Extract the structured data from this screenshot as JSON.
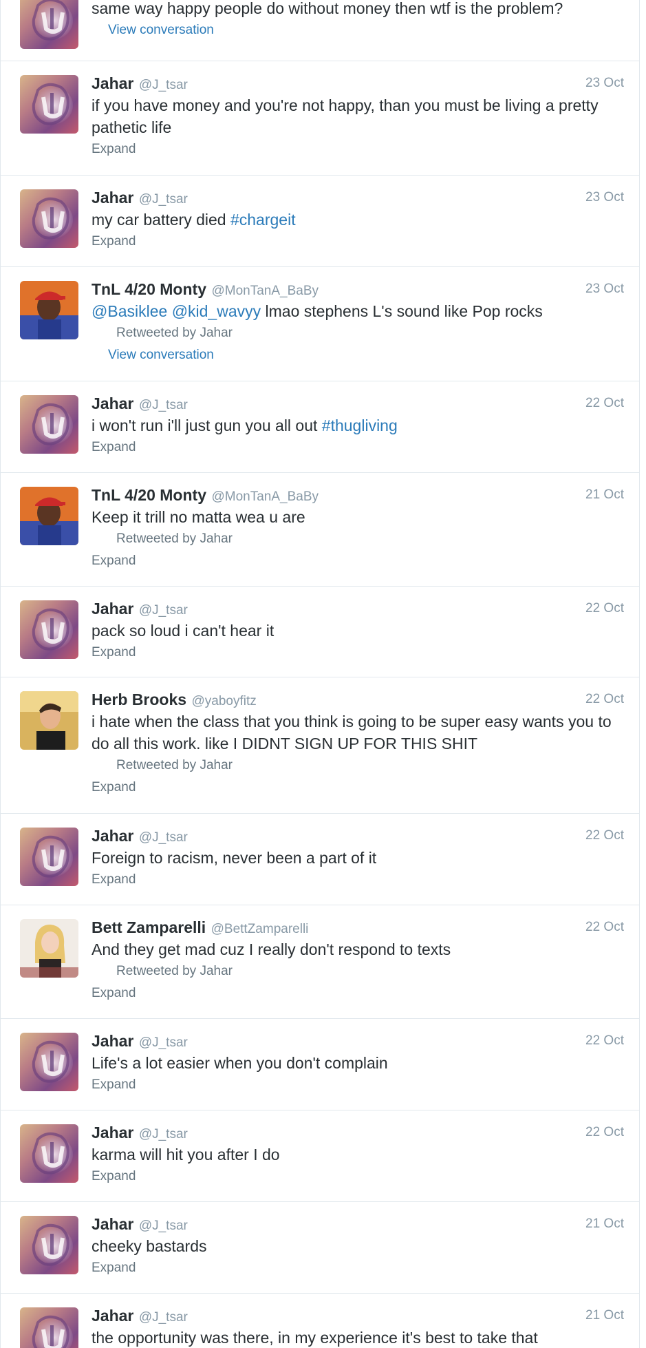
{
  "timeline": {
    "tweets": [
      {
        "avatar": "jahar-avatar",
        "text_parts": [
          {
            "t": "same way happy people do without money then wtf is the problem?"
          }
        ],
        "retweeted_by": "",
        "action": "View conversation"
      },
      {
        "name": "Jahar",
        "handle": "@J_tsar",
        "time": "23 Oct",
        "avatar": "jahar-avatar",
        "text_parts": [
          {
            "t": "if you have money and you're not happy, than you must be living a pretty pathetic life"
          }
        ],
        "retweeted_by": "",
        "action": "Expand"
      },
      {
        "name": "Jahar",
        "handle": "@J_tsar",
        "time": "23 Oct",
        "avatar": "jahar-avatar",
        "text_parts": [
          {
            "t": "my car battery died "
          },
          {
            "t": "#chargeit",
            "link": true
          }
        ],
        "retweeted_by": "",
        "action": "Expand"
      },
      {
        "name": "TnL 4/20 Monty",
        "handle": "@MonTanA_BaBy",
        "time": "23 Oct",
        "avatar": "monty-avatar",
        "text_parts": [
          {
            "t": "@Basiklee",
            "link": true
          },
          {
            "t": " "
          },
          {
            "t": "@kid_wavyy",
            "link": true
          },
          {
            "t": " lmao stephens L's sound like Pop rocks"
          }
        ],
        "retweeted_by": "Retweeted by Jahar",
        "action": "View conversation"
      },
      {
        "name": "Jahar",
        "handle": "@J_tsar",
        "time": "22 Oct",
        "avatar": "jahar-avatar",
        "text_parts": [
          {
            "t": "i won't run i'll just gun you all out "
          },
          {
            "t": "#thugliving",
            "link": true
          }
        ],
        "retweeted_by": "",
        "action": "Expand"
      },
      {
        "name": "TnL 4/20 Monty",
        "handle": "@MonTanA_BaBy",
        "time": "21 Oct",
        "avatar": "monty-avatar",
        "text_parts": [
          {
            "t": "Keep it trill no matta wea u are"
          }
        ],
        "retweeted_by": "Retweeted by Jahar",
        "action": "Expand"
      },
      {
        "name": "Jahar",
        "handle": "@J_tsar",
        "time": "22 Oct",
        "avatar": "jahar-avatar",
        "text_parts": [
          {
            "t": "pack so loud i can't hear it"
          }
        ],
        "retweeted_by": "",
        "action": "Expand"
      },
      {
        "name": "Herb Brooks",
        "handle": "@yaboyfitz",
        "time": "22 Oct",
        "avatar": "herb-avatar",
        "text_parts": [
          {
            "t": "i hate when the class that you think is going to be super easy wants you to do all this work. like I DIDNT SIGN UP FOR THIS SHIT"
          }
        ],
        "retweeted_by": "Retweeted by Jahar",
        "action": "Expand"
      },
      {
        "name": "Jahar",
        "handle": "@J_tsar",
        "time": "22 Oct",
        "avatar": "jahar-avatar",
        "text_parts": [
          {
            "t": "Foreign to racism, never been a part of it"
          }
        ],
        "retweeted_by": "",
        "action": "Expand"
      },
      {
        "name": "Bett Zamparelli",
        "handle": "@BettZamparelli",
        "time": "22 Oct",
        "avatar": "bett-avatar",
        "text_parts": [
          {
            "t": "And they get mad cuz I really don't respond to texts"
          }
        ],
        "retweeted_by": "Retweeted by Jahar",
        "action": "Expand"
      },
      {
        "name": "Jahar",
        "handle": "@J_tsar",
        "time": "22 Oct",
        "avatar": "jahar-avatar",
        "text_parts": [
          {
            "t": "Life's a lot easier when you don't complain"
          }
        ],
        "retweeted_by": "",
        "action": "Expand"
      },
      {
        "name": "Jahar",
        "handle": "@J_tsar",
        "time": "22 Oct",
        "avatar": "jahar-avatar",
        "text_parts": [
          {
            "t": "karma will hit you after I do"
          }
        ],
        "retweeted_by": "",
        "action": "Expand"
      },
      {
        "name": "Jahar",
        "handle": "@J_tsar",
        "time": "21 Oct",
        "avatar": "jahar-avatar",
        "text_parts": [
          {
            "t": "cheeky bastards"
          }
        ],
        "retweeted_by": "",
        "action": "Expand"
      },
      {
        "name": "Jahar",
        "handle": "@J_tsar",
        "time": "21 Oct",
        "avatar": "jahar-avatar",
        "text_parts": [
          {
            "t": "the opportunity was there, in my experience it's best to take that"
          }
        ],
        "retweeted_by": "",
        "action": ""
      }
    ]
  }
}
